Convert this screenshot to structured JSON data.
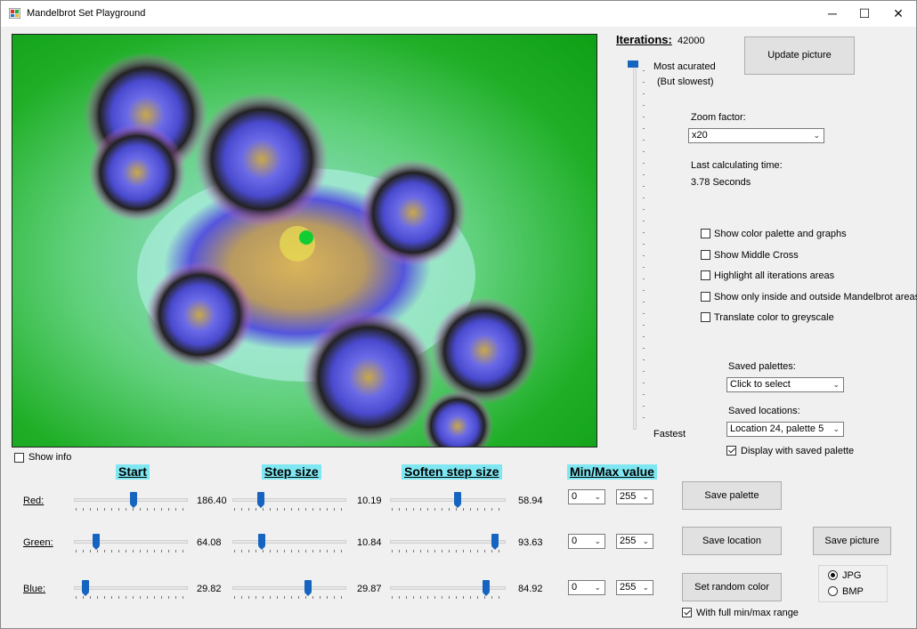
{
  "window": {
    "title": "Mandelbrot Set Playground",
    "minimize": "─",
    "maximize": "☐",
    "close": "✕"
  },
  "iterations": {
    "label": "Iterations:",
    "value": "42000",
    "most": "Most acurated",
    "most_sub": "(But slowest)",
    "fastest": "Fastest",
    "level": 1.0
  },
  "update_button": "Update picture",
  "zoom": {
    "label": "Zoom factor:",
    "value": "x20"
  },
  "calc": {
    "label": "Last calculating time:",
    "value": "3.78 Seconds"
  },
  "options": [
    {
      "label": "Show color palette and graphs",
      "checked": false
    },
    {
      "label": "Show Middle Cross",
      "checked": false
    },
    {
      "label": "Highlight all iterations areas",
      "checked": false
    },
    {
      "label": "Show only inside and outside Mandelbrot areas",
      "checked": false
    },
    {
      "label": "Translate color to greyscale",
      "checked": false
    }
  ],
  "saved_palettes": {
    "label": "Saved palettes:",
    "value": "Click to select"
  },
  "saved_locations": {
    "label": "Saved locations:",
    "value": "Location 24, palette 5"
  },
  "display_saved": {
    "label": "Display with saved palette",
    "checked": true
  },
  "show_info": {
    "label": "Show info",
    "checked": false
  },
  "headers": {
    "start": "Start",
    "step": "Step size",
    "soften": "Soften step size",
    "minmax": "Min/Max value"
  },
  "rows": [
    {
      "label": "Red:",
      "start": "186.40",
      "step": "10.19",
      "soften": "58.94",
      "min": "0",
      "max": "255"
    },
    {
      "label": "Green:",
      "start": "64.08",
      "step": "10.84",
      "soften": "93.63",
      "min": "0",
      "max": "255"
    },
    {
      "label": "Blue:",
      "start": "29.82",
      "step": "29.87",
      "soften": "84.92",
      "min": "0",
      "max": "255"
    }
  ],
  "buttons": {
    "save_palette": "Save  palette",
    "save_location": "Save location",
    "save_picture": "Save picture",
    "random_color": "Set random color"
  },
  "full_range": {
    "label": "With full min/max range",
    "checked": true
  },
  "format": {
    "jpg": "JPG",
    "bmp": "BMP",
    "selected": "JPG"
  },
  "arrow": "⌄"
}
